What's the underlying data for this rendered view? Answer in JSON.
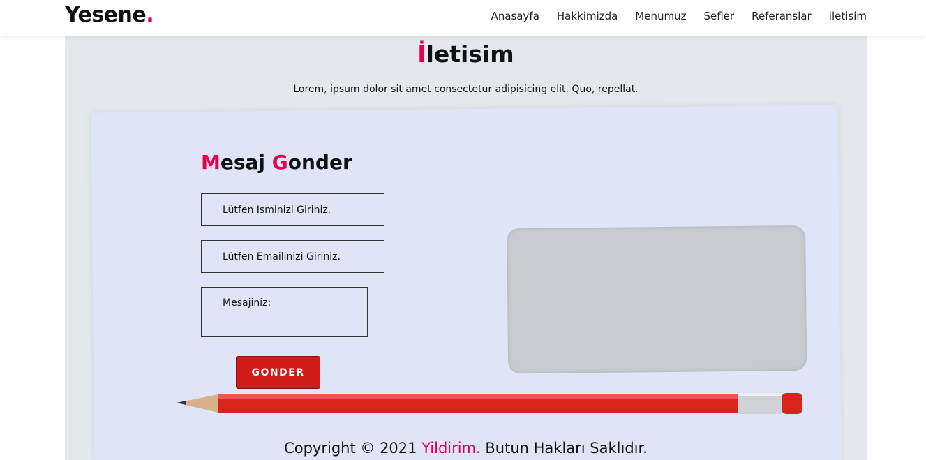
{
  "logo": {
    "text": "Yesene",
    "dot": "."
  },
  "nav": [
    {
      "label": "Anasayfa"
    },
    {
      "label": "Hakkimizda"
    },
    {
      "label": "Menumuz"
    },
    {
      "label": "Sefler"
    },
    {
      "label": "Referanslar"
    },
    {
      "label": "iletisim"
    }
  ],
  "page": {
    "title_first": "İ",
    "title_rest": "letisim",
    "lead": "Lorem, ipsum dolor sit amet consectetur adipisicing elit. Quo, repellat."
  },
  "form": {
    "title_m": "M",
    "title_mid": "esaj ",
    "title_g": "G",
    "title_rest": "onder",
    "name_placeholder": "Lütfen İsminizi Giriniz.",
    "email_placeholder": "Lütfen Emailinizi Giriniz.",
    "message_placeholder": "Mesajiniz:",
    "submit_label": "GONDER"
  },
  "footer": {
    "prefix": "Copyright © 2021 ",
    "brand": "Yildirim.",
    "suffix": " Butun Hakları Saklıdır."
  },
  "colors": {
    "accent": "#e4004d",
    "button": "#d11a1a"
  }
}
